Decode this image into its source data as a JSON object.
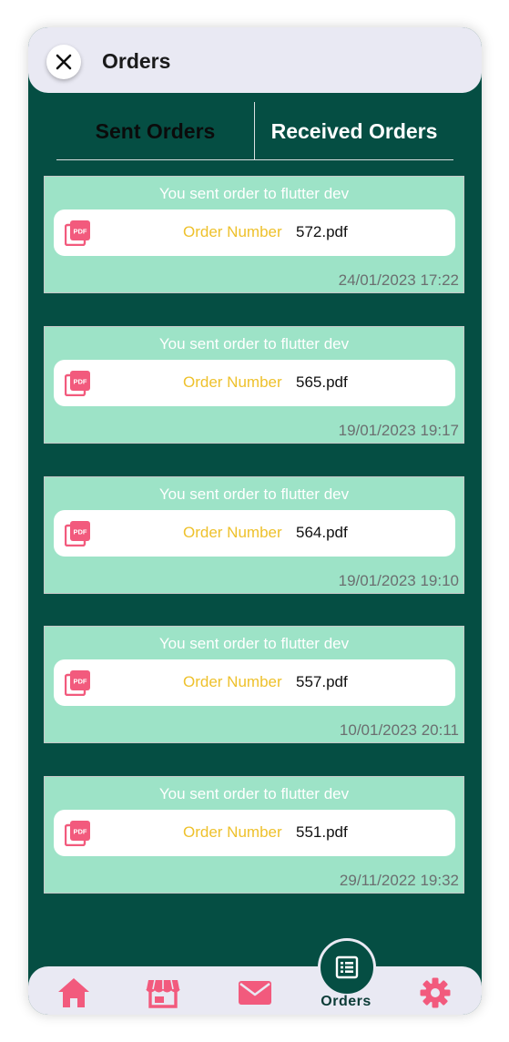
{
  "appbar": {
    "title": "Orders",
    "close_icon": "close-icon"
  },
  "tabs": [
    {
      "label": "Sent Orders",
      "active": true
    },
    {
      "label": "Received Orders",
      "active": false
    }
  ],
  "orders": [
    {
      "header": "You sent order to flutter dev",
      "label": "Order Number",
      "file": "572.pdf",
      "timestamp": "24/01/2023 17:22"
    },
    {
      "header": "You sent order to flutter dev",
      "label": "Order Number",
      "file": "565.pdf",
      "timestamp": "19/01/2023 19:17"
    },
    {
      "header": "You sent order to flutter dev",
      "label": "Order Number",
      "file": "564.pdf",
      "timestamp": "19/01/2023 19:10"
    },
    {
      "header": "You sent order to flutter dev",
      "label": "Order Number",
      "file": "557.pdf",
      "timestamp": "10/01/2023 20:11"
    },
    {
      "header": "You sent order to flutter dev",
      "label": "Order Number",
      "file": "551.pdf",
      "timestamp": "29/11/2022 19:32"
    }
  ],
  "bottom_nav": {
    "items": [
      {
        "icon": "home-icon"
      },
      {
        "icon": "store-icon"
      },
      {
        "icon": "mail-icon"
      },
      {
        "icon": "orders-icon",
        "label": "Orders",
        "active": true
      },
      {
        "icon": "gear-icon"
      }
    ]
  },
  "colors": {
    "background": "#054e43",
    "card": "#9de3c7",
    "accent": "#f25a7d",
    "order_label": "#eec12c"
  }
}
